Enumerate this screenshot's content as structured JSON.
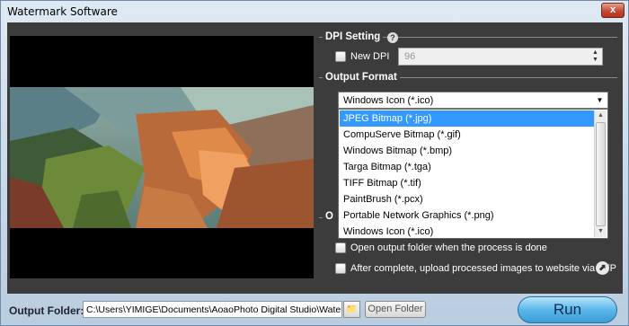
{
  "window": {
    "title": "Watermark Software",
    "close_symbol": "x"
  },
  "dpi": {
    "title": "DPI Setting",
    "help_symbol": "?",
    "new_dpi_label": "New DPI",
    "new_dpi_checked": false,
    "value": "96"
  },
  "output_format": {
    "title": "Output Format",
    "selected": "Windows Icon (*.ico)",
    "options": [
      "JPEG Bitmap (*.jpg)",
      "CompuServe Bitmap (*.gif)",
      "Windows Bitmap (*.bmp)",
      "Targa Bitmap (*.tga)",
      "TIFF Bitmap (*.tif)",
      "PaintBrush (*.pcx)",
      "Portable Network Graphics (*.png)",
      "Windows Icon (*.ico)"
    ],
    "highlighted_index": 0
  },
  "options": {
    "partial_title": "O",
    "open_folder_label": "Open output folder when the process is done",
    "upload_label": "After complete, upload processed images to website via FTP"
  },
  "bottom": {
    "output_folder_label": "Output Folder:",
    "path": "C:\\Users\\YIMIGE\\Documents\\AoaoPhoto Digital Studio\\Watermark Sof",
    "open_folder_button": "Open Folder",
    "run_button": "Run"
  },
  "icons": {
    "help": "help-icon",
    "upload": "upload-icon",
    "folder": "folder-icon",
    "dropdown": "chevron-down-icon"
  }
}
